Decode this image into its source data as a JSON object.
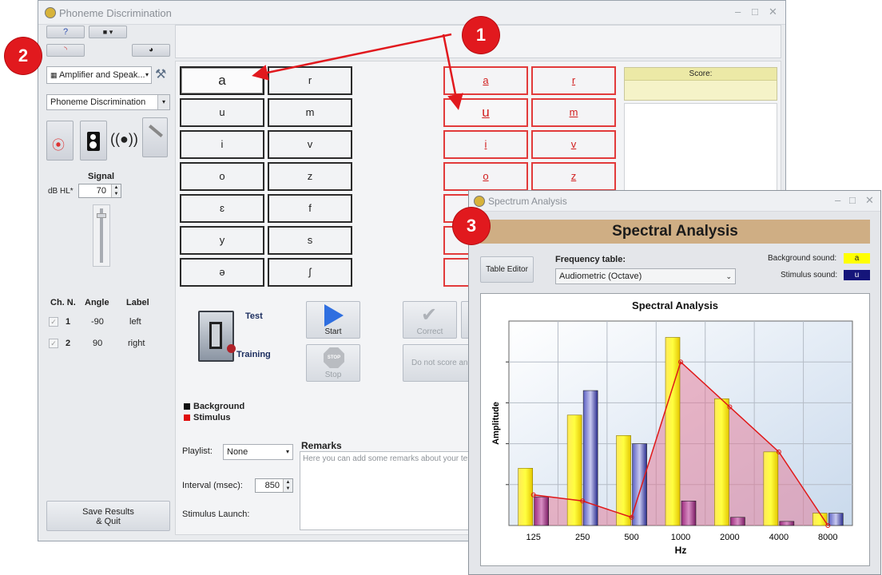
{
  "main_window": {
    "title": "Phoneme Discrimination",
    "device_select": "Amplifier and Speak...",
    "test_select": "Phoneme Discrimination",
    "signal_label": "Signal",
    "db_label": "dB HL*",
    "db_value": "70",
    "channels": {
      "headers": [
        "Ch. N.",
        "Angle",
        "Label"
      ],
      "rows": [
        {
          "ch": "1",
          "angle": "-90",
          "label": "left"
        },
        {
          "ch": "2",
          "angle": "90",
          "label": "right"
        }
      ]
    },
    "save_button": "Save Results\n& Quit",
    "background_phonemes": [
      "a",
      "r",
      "u",
      "m",
      "i",
      "v",
      "o",
      "z",
      "ɛ",
      "f",
      "y",
      "s",
      "ə",
      "ʃ"
    ],
    "stimulus_phonemes": [
      "a",
      "r",
      "u",
      "m",
      "i",
      "v",
      "o",
      "z"
    ],
    "mode_test": "Test",
    "mode_training": "Training",
    "start_label": "Start",
    "stop_label": "Stop",
    "correct_label": "Correct",
    "do_not_score_label": "Do not score an",
    "legend_background": "Background",
    "legend_stimulus": "Stimulus",
    "playlist_label": "Playlist:",
    "playlist_value": "None",
    "interval_label": "Interval (msec):",
    "interval_value": "850",
    "stimulus_launch_label": "Stimulus Launch:",
    "remarks_label": "Remarks",
    "remarks_placeholder": "Here you can add some remarks about your tes",
    "score_label": "Score:"
  },
  "spectrum_window": {
    "title": "Spectrum Analysis",
    "header": "Spectral Analysis",
    "table_editor": "Table Editor",
    "frequency_table_label": "Frequency table:",
    "frequency_table_value": "Audiometric (Octave)",
    "background_sound_label": "Background sound:",
    "background_sound_value": "a",
    "stimulus_sound_label": "Stimulus sound:",
    "stimulus_sound_value": "u"
  },
  "markers": [
    "1",
    "2",
    "3"
  ],
  "colors": {
    "marker": "#e1191e",
    "stim_red": "#e23a3a",
    "bg_sound": "#ffff00",
    "stim_sound": "#1a1a8c"
  },
  "chart_data": {
    "type": "bar",
    "title": "Spectral Analysis",
    "xlabel": "Hz",
    "ylabel": "Amplitude",
    "categories": [
      "125",
      "250",
      "500",
      "1000",
      "2000",
      "4000",
      "8000"
    ],
    "series": [
      {
        "name": "a",
        "values": [
          14,
          27,
          22,
          46,
          31,
          18,
          3
        ]
      },
      {
        "name": "u",
        "values": [
          7,
          33,
          20,
          6,
          2,
          1,
          3
        ]
      }
    ],
    "line": [
      7.5,
      6,
      2,
      40,
      29,
      18,
      0
    ],
    "ylim": [
      0,
      50
    ],
    "grid": true
  }
}
